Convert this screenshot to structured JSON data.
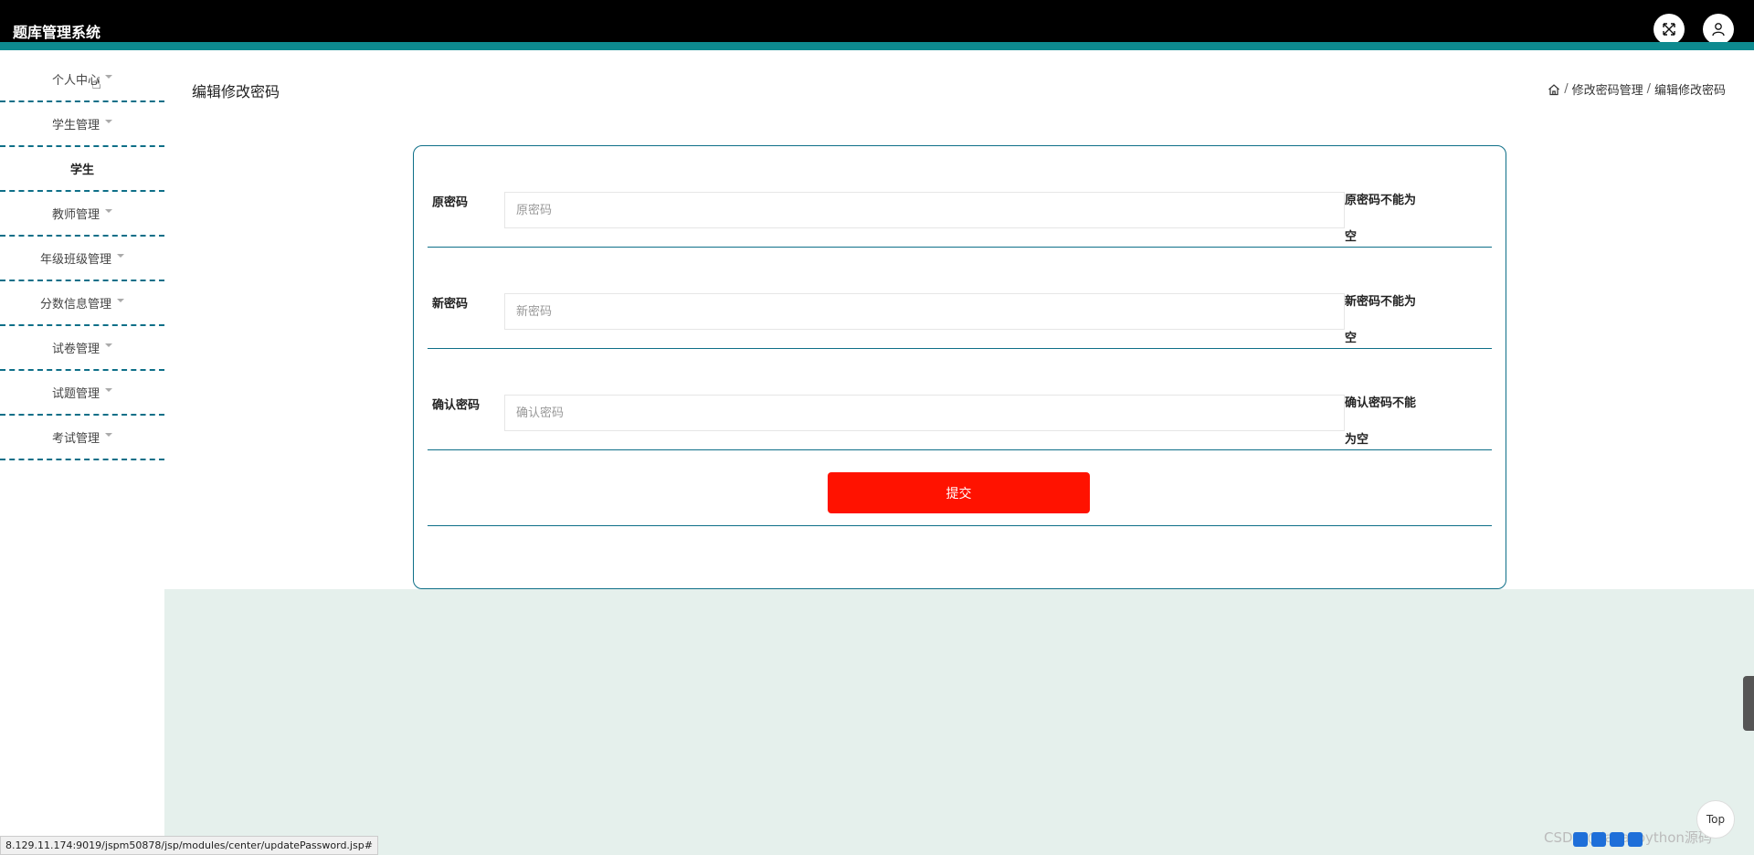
{
  "app": {
    "title": "题库管理系统"
  },
  "header": {
    "fullscreen_icon": "fullscreen-icon",
    "user_icon": "user-icon"
  },
  "sidebar": {
    "items": [
      {
        "label": "个人中心",
        "has_caret": true
      },
      {
        "label": "学生管理",
        "has_caret": true
      },
      {
        "label": "学生",
        "has_caret": false
      },
      {
        "label": "教师管理",
        "has_caret": true
      },
      {
        "label": "年级班级管理",
        "has_caret": true
      },
      {
        "label": "分数信息管理",
        "has_caret": true
      },
      {
        "label": "试卷管理",
        "has_caret": true
      },
      {
        "label": "试题管理",
        "has_caret": true
      },
      {
        "label": "考试管理",
        "has_caret": true
      }
    ]
  },
  "page": {
    "title": "编辑修改密码",
    "breadcrumb": {
      "home_icon": "home-icon",
      "items": [
        "修改密码管理",
        "编辑修改密码"
      ]
    }
  },
  "form": {
    "fields": [
      {
        "label": "原密码",
        "placeholder": "原密码",
        "value": "",
        "error": "原密码不能为空"
      },
      {
        "label": "新密码",
        "placeholder": "新密码",
        "value": "",
        "error": "新密码不能为空"
      },
      {
        "label": "确认密码",
        "placeholder": "确认密码",
        "value": "",
        "error": "确认密码不能为空"
      }
    ],
    "submit_label": "提交"
  },
  "status_bar": {
    "url": "8.129.11.174:9019/jspm50878/jsp/modules/center/updatePassword.jsp#"
  },
  "float": {
    "top_label": "Top"
  },
  "watermark": "CSDN @java_python源码",
  "colors": {
    "topbar": "#000000",
    "accent": "#0d8a8f",
    "border": "#0e6f88",
    "submit": "#ff1200",
    "lower_bg": "#e5f0ec"
  }
}
